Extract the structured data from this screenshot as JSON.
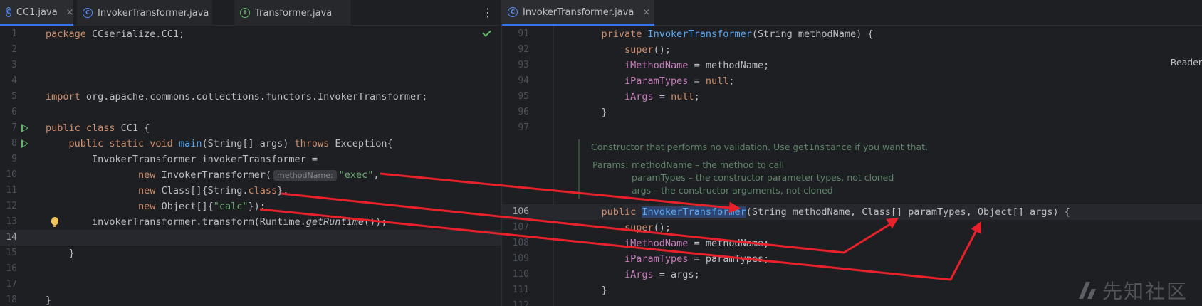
{
  "left_tabs": [
    {
      "icon": "class-icon",
      "label": "CC1.java",
      "close": "×"
    },
    {
      "icon": "class-icon",
      "label": "InvokerTransformer.java"
    },
    {
      "icon": "interface-icon",
      "label": "Transformer.java"
    }
  ],
  "left_menu_glyph": "⋮",
  "left_lines": [
    {
      "n": "1",
      "segs": [
        {
          "t": "package ",
          "c": "kw"
        },
        {
          "t": "CCserialize.CC1;"
        }
      ]
    },
    {
      "n": "2",
      "segs": []
    },
    {
      "n": "3",
      "segs": []
    },
    {
      "n": "4",
      "segs": []
    },
    {
      "n": "5",
      "segs": [
        {
          "t": "import ",
          "c": "kw"
        },
        {
          "t": "org.apache.commons.collections.functors.InvokerTransformer;"
        }
      ]
    },
    {
      "n": "6",
      "segs": []
    },
    {
      "n": "7",
      "segs": [
        {
          "t": "public class ",
          "c": "kw"
        },
        {
          "t": "CC1 {"
        }
      ]
    },
    {
      "n": "8",
      "segs": [
        {
          "t": "    public static void ",
          "c": "kw"
        },
        {
          "t": "main",
          "c": "fn"
        },
        {
          "t": "(String[] args) "
        },
        {
          "t": "throws ",
          "c": "kw"
        },
        {
          "t": "Exception{"
        }
      ]
    },
    {
      "n": "9",
      "segs": [
        {
          "t": "        InvokerTransformer invokerTransformer ="
        }
      ]
    },
    {
      "n": "10",
      "segs": [
        {
          "t": "                "
        },
        {
          "t": "new ",
          "c": "kw"
        },
        {
          "t": "InvokerTransformer("
        },
        {
          "t": "methodName:",
          "c": "hint"
        },
        {
          "t": "\"exec\"",
          "c": "str"
        },
        {
          "t": ","
        }
      ]
    },
    {
      "n": "11",
      "segs": [
        {
          "t": "                "
        },
        {
          "t": "new ",
          "c": "kw"
        },
        {
          "t": "Class[]{String."
        },
        {
          "t": "class",
          "c": "kw"
        },
        {
          "t": "},"
        }
      ]
    },
    {
      "n": "12",
      "segs": [
        {
          "t": "                "
        },
        {
          "t": "new ",
          "c": "kw"
        },
        {
          "t": "Object[]{"
        },
        {
          "t": "\"calc\"",
          "c": "str"
        },
        {
          "t": "});"
        }
      ]
    },
    {
      "n": "13",
      "segs": [
        {
          "t": "        invokerTransformer.transform(Runtime."
        },
        {
          "t": "getRuntime",
          "c": "it"
        },
        {
          "t": "());"
        }
      ]
    },
    {
      "n": "14",
      "segs": [],
      "current": true
    },
    {
      "n": "15",
      "segs": [
        {
          "t": "    }"
        }
      ]
    },
    {
      "n": "16",
      "segs": []
    },
    {
      "n": "17",
      "segs": []
    },
    {
      "n": "18",
      "segs": [
        {
          "t": "}"
        }
      ]
    }
  ],
  "right_tab": {
    "icon": "class-icon",
    "label": "InvokerTransformer.java",
    "close": "×"
  },
  "reader_label": "Reader",
  "right_lines_top": [
    {
      "n": "91",
      "segs": [
        {
          "t": "    "
        },
        {
          "t": "private ",
          "c": "kw"
        },
        {
          "t": "InvokerTransformer",
          "c": "fn"
        },
        {
          "t": "(String methodName) {"
        }
      ]
    },
    {
      "n": "92",
      "segs": [
        {
          "t": "        "
        },
        {
          "t": "super",
          "c": "kw"
        },
        {
          "t": "();"
        }
      ]
    },
    {
      "n": "93",
      "segs": [
        {
          "t": "        "
        },
        {
          "t": "iMethodName",
          "c": "fld"
        },
        {
          "t": " = methodName;"
        }
      ]
    },
    {
      "n": "94",
      "segs": [
        {
          "t": "        "
        },
        {
          "t": "iParamTypes",
          "c": "fld"
        },
        {
          "t": " = "
        },
        {
          "t": "null",
          "c": "kw"
        },
        {
          "t": ";"
        }
      ]
    },
    {
      "n": "95",
      "segs": [
        {
          "t": "        "
        },
        {
          "t": "iArgs",
          "c": "fld"
        },
        {
          "t": " = "
        },
        {
          "t": "null",
          "c": "kw"
        },
        {
          "t": ";"
        }
      ]
    },
    {
      "n": "96",
      "segs": [
        {
          "t": "    }"
        }
      ]
    },
    {
      "n": "97",
      "segs": []
    }
  ],
  "doc": {
    "summary_a": "Constructor that performs no validation. Use ",
    "summary_code": "getInstance",
    "summary_b": " if you want that.",
    "params_label": "Params:",
    "params": [
      {
        "name": "methodName",
        "desc": " – the method to call"
      },
      {
        "name": "paramTypes",
        "desc": " – the constructor parameter types, not cloned"
      },
      {
        "name": "args",
        "desc": " – the constructor arguments, not cloned"
      }
    ]
  },
  "right_lines_bottom": [
    {
      "n": "106",
      "segs": [
        {
          "t": "    "
        },
        {
          "t": "public ",
          "c": "kw"
        },
        {
          "t": "InvokerTransformer",
          "c": "fn hl"
        },
        {
          "t": "(String methodName, Class[] paramTypes, Object[] args) {"
        }
      ],
      "current": true
    },
    {
      "n": "107",
      "segs": [
        {
          "t": "        "
        },
        {
          "t": "super",
          "c": "kw"
        },
        {
          "t": "();"
        }
      ]
    },
    {
      "n": "108",
      "segs": [
        {
          "t": "        "
        },
        {
          "t": "iMethodName",
          "c": "fld"
        },
        {
          "t": " = methodName;"
        }
      ]
    },
    {
      "n": "109",
      "segs": [
        {
          "t": "        "
        },
        {
          "t": "iParamTypes",
          "c": "fld"
        },
        {
          "t": " = paramTypes;"
        }
      ]
    },
    {
      "n": "110",
      "segs": [
        {
          "t": "        "
        },
        {
          "t": "iArgs",
          "c": "fld"
        },
        {
          "t": " = args;"
        }
      ]
    },
    {
      "n": "111",
      "segs": [
        {
          "t": "    }"
        }
      ]
    },
    {
      "n": "112",
      "segs": []
    }
  ],
  "watermark": "先知社区",
  "colors": {
    "arrow": "#e8212b",
    "accent": "#3574f0",
    "background": "#1e1f22"
  }
}
